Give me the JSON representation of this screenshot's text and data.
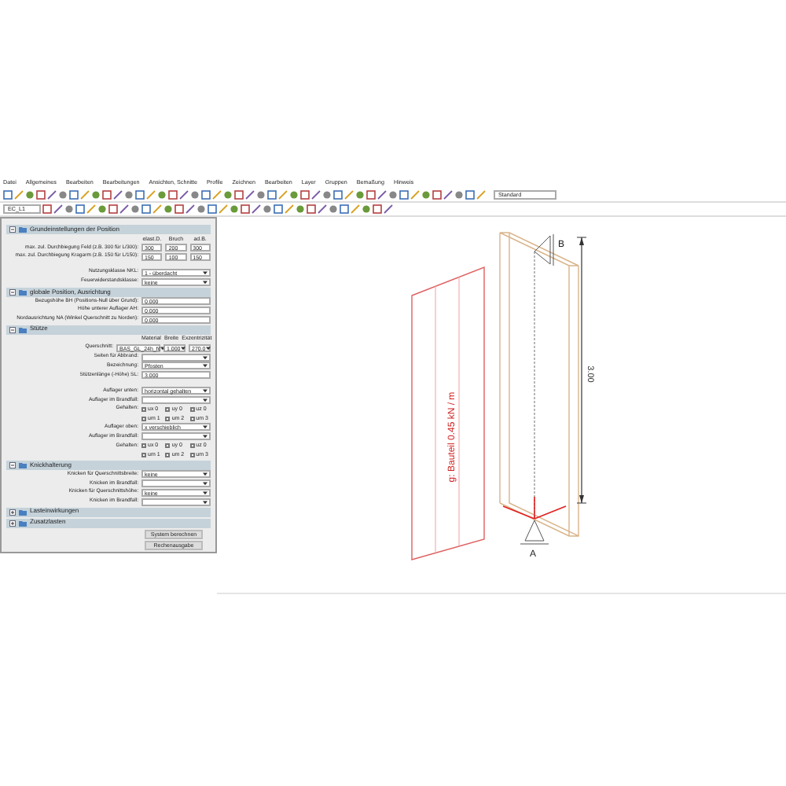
{
  "menu": [
    "Datei",
    "Allgemeines",
    "Bearbeiten",
    "Bearbeitungen",
    "Ansichten, Schnitte",
    "Profile",
    "Zeichnen",
    "Bearbeiten",
    "Layer",
    "Gruppen",
    "Bemaßung",
    "Hinweis"
  ],
  "toolbar": {
    "layer": "EC_L1",
    "style": "Standard"
  },
  "sections": [
    {
      "title": "Grundeinstellungen der Position",
      "expanded": true,
      "rows": [
        {
          "kind": "header",
          "values": [
            "elast.D.",
            "Bruch",
            "ad.B."
          ]
        },
        {
          "kind": "triple",
          "label": "max. zul. Durchbiegung Feld (z.B. 300 für L/300):",
          "values": [
            "300",
            "200",
            "300"
          ]
        },
        {
          "kind": "triple",
          "label": "max. zul. Durchbiegung Kragarm (z.B. 150 für L/150):",
          "values": [
            "150",
            "100",
            "150"
          ]
        },
        {
          "kind": "gap"
        },
        {
          "kind": "select",
          "label": "Nutzungsklasse NKL:",
          "value": "1 - überdacht"
        },
        {
          "kind": "select",
          "label": "Feuerwiderstandsklasse:",
          "value": "keine"
        }
      ]
    },
    {
      "title": "globale Position, Ausrichtung",
      "expanded": true,
      "rows": [
        {
          "kind": "input",
          "label": "Bezugshöhe BH (Positions-Null über Grund):",
          "value": "0.000"
        },
        {
          "kind": "input",
          "label": "Höhe unterer Auflager AH:",
          "value": "0.000"
        },
        {
          "kind": "input",
          "label": "Nordausrichtung NA (Winkel Querschnitt zu Norden):",
          "value": "0.000"
        }
      ]
    },
    {
      "title": "Stütze",
      "expanded": true,
      "rows": [
        {
          "kind": "header",
          "values": [
            "Material",
            "Breite",
            "Exzentrizität"
          ]
        },
        {
          "kind": "profile",
          "label": "Querschnitt:",
          "values": [
            "BAS_GL_24h_fc",
            "1.000",
            "270.0"
          ]
        },
        {
          "kind": "select",
          "label": "Seiten für Abbrand:",
          "value": ""
        },
        {
          "kind": "select",
          "label": "Bezeichnung:",
          "value": "Pfosten"
        },
        {
          "kind": "input",
          "label": "Stützenlänge (-Höhe) SL:",
          "value": "3.000"
        },
        {
          "kind": "gap"
        },
        {
          "kind": "select",
          "label": "Auflager unten:",
          "value": "horizontal gehalten"
        },
        {
          "kind": "select",
          "label": "Auflager im Brandfall:",
          "value": ""
        },
        {
          "kind": "checks",
          "label": "Gehalten:",
          "items": [
            {
              "label": "ux 0",
              "checked": false
            },
            {
              "label": "uy 0",
              "checked": false
            },
            {
              "label": "uz 0",
              "checked": false
            },
            {
              "label": "um 1",
              "checked": false
            },
            {
              "label": "um 2",
              "checked": false
            },
            {
              "label": "um 3",
              "checked": false
            }
          ]
        },
        {
          "kind": "select",
          "label": "Auflager oben:",
          "value": "x verschieblich"
        },
        {
          "kind": "select",
          "label": "Auflager im Brandfall:",
          "value": ""
        },
        {
          "kind": "checks",
          "label": "Gehalten:",
          "items": [
            {
              "label": "ux 0",
              "checked": false
            },
            {
              "label": "uy 0",
              "checked": false
            },
            {
              "label": "uz 0",
              "checked": false
            },
            {
              "label": "um 1",
              "checked": false
            },
            {
              "label": "um 2",
              "checked": false
            },
            {
              "label": "um 3",
              "checked": false
            }
          ]
        }
      ]
    },
    {
      "title": "Knickhalterung",
      "expanded": true,
      "rows": [
        {
          "kind": "select",
          "label": "Knicken für Querschnittsbreite:",
          "value": "keine"
        },
        {
          "kind": "select",
          "label": "Knicken im Brandfall:",
          "value": ""
        },
        {
          "kind": "select",
          "label": "Knicken für Querschnittshöhe:",
          "value": "keine"
        },
        {
          "kind": "select",
          "label": "Knicken im Brandfall:",
          "value": ""
        }
      ]
    },
    {
      "title": "Lasteinwirkungen",
      "expanded": false
    },
    {
      "title": "Zusatzlasten",
      "expanded": false
    }
  ],
  "buttons": [
    "System berechnen",
    "Rechenausgabe"
  ],
  "drawing": {
    "load_label": "g: Bauteil 0.45 kN / m",
    "dimension": "3.00",
    "support_bottom": "A",
    "support_top": "B"
  }
}
